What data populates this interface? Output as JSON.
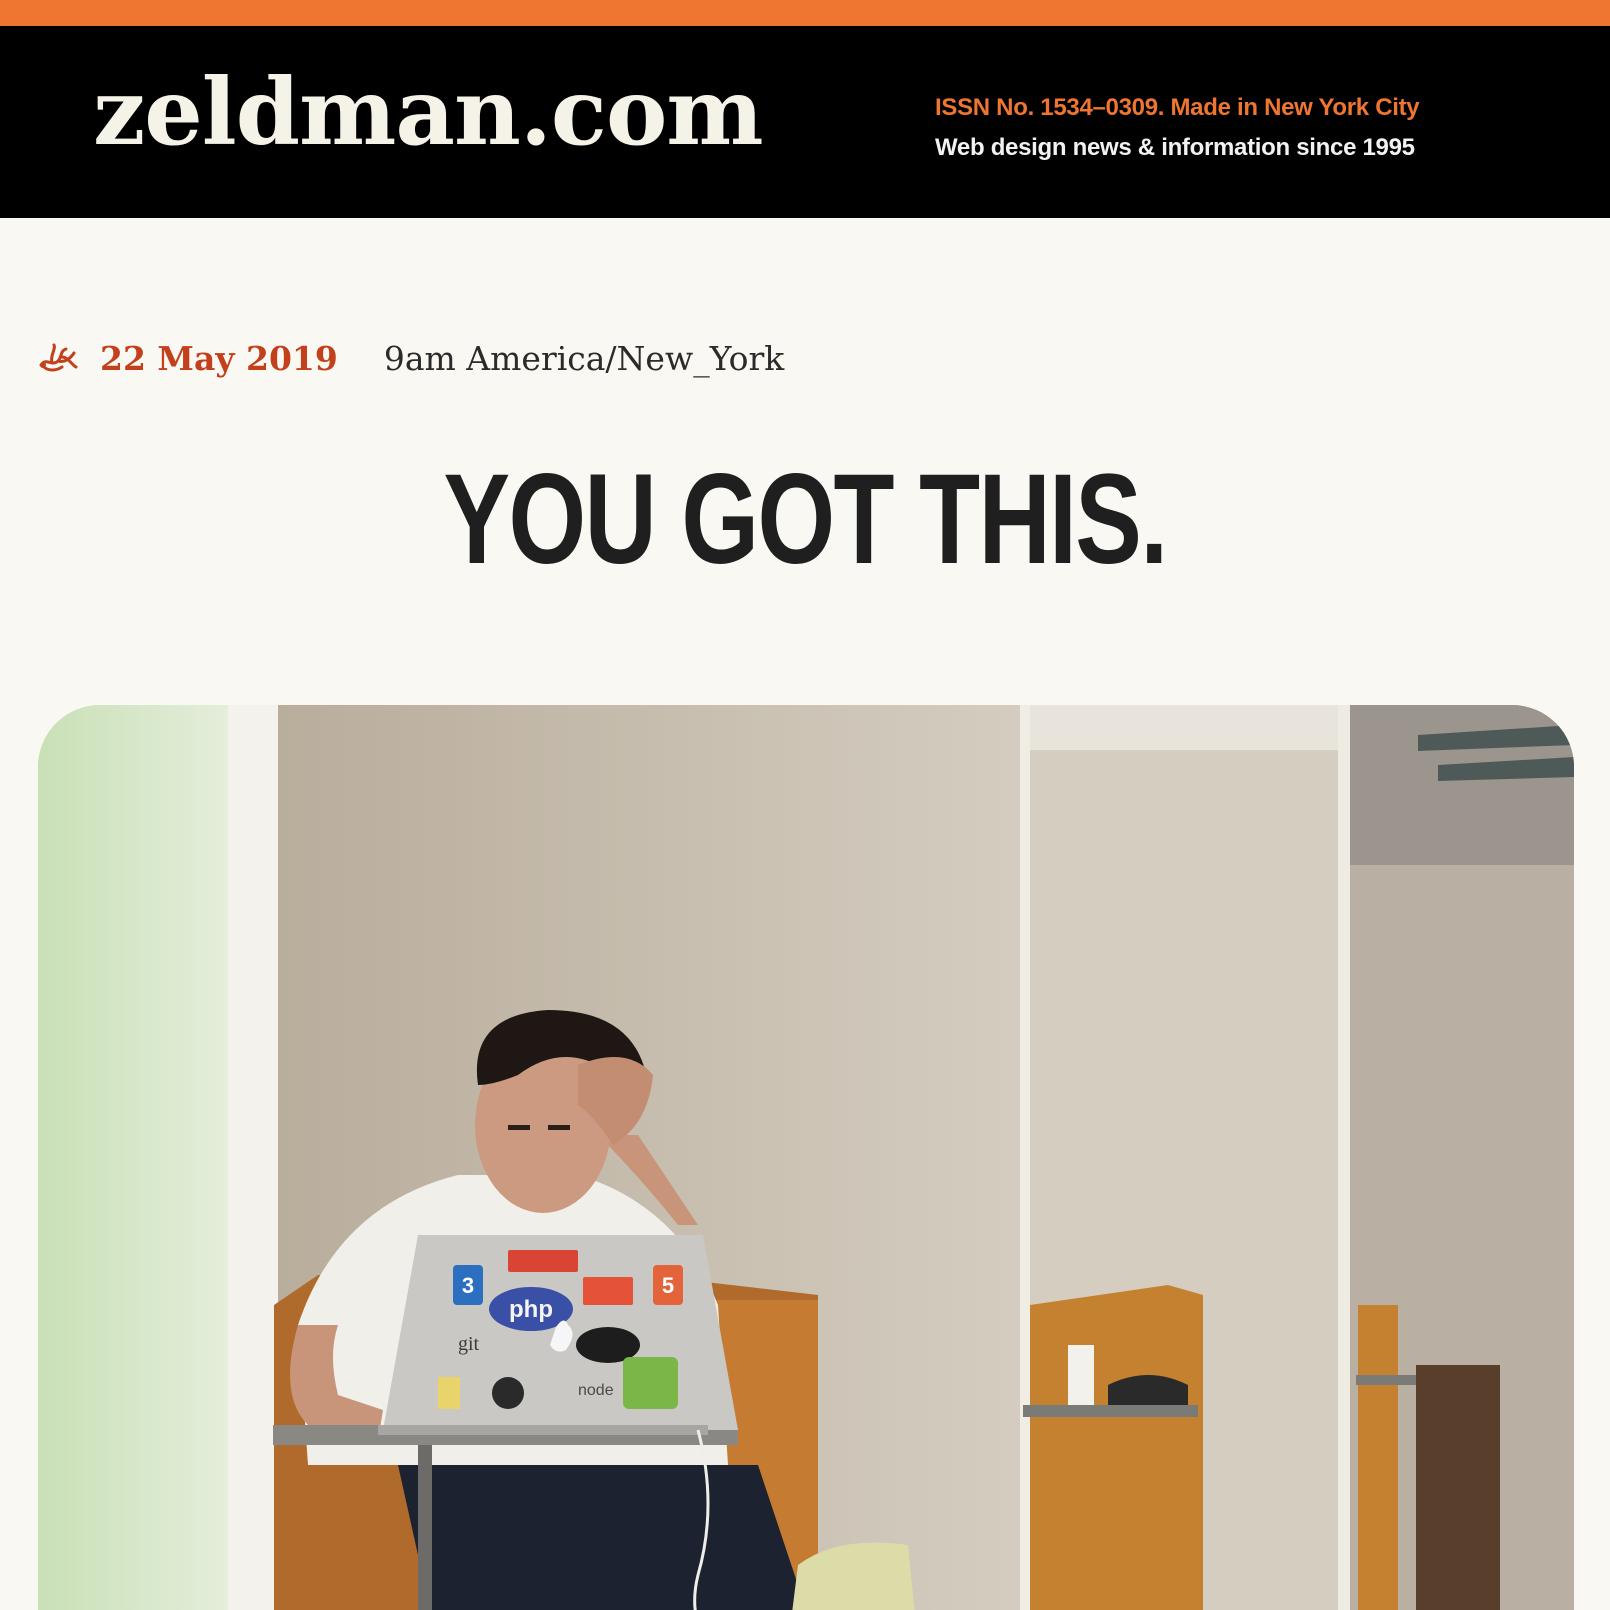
{
  "header": {
    "logo_text": "zeldman.com",
    "tagline_line1": "ISSN No. 1534–0309.  Made in New York City",
    "tagline_line2": "Web design news & information since 1995"
  },
  "post": {
    "date": "22 May 2019",
    "time": "9am America/New_York",
    "title": "YOU GOT THIS."
  },
  "hero_image": {
    "sticker_labels": [
      "php",
      "git",
      "5",
      "3",
      "node"
    ]
  },
  "colors": {
    "accent": "#ee7630",
    "date": "#c2401c",
    "masthead_bg": "#000000",
    "page_bg": "#f9f8f3"
  },
  "icons": {
    "post_format": "ornament-icon"
  }
}
